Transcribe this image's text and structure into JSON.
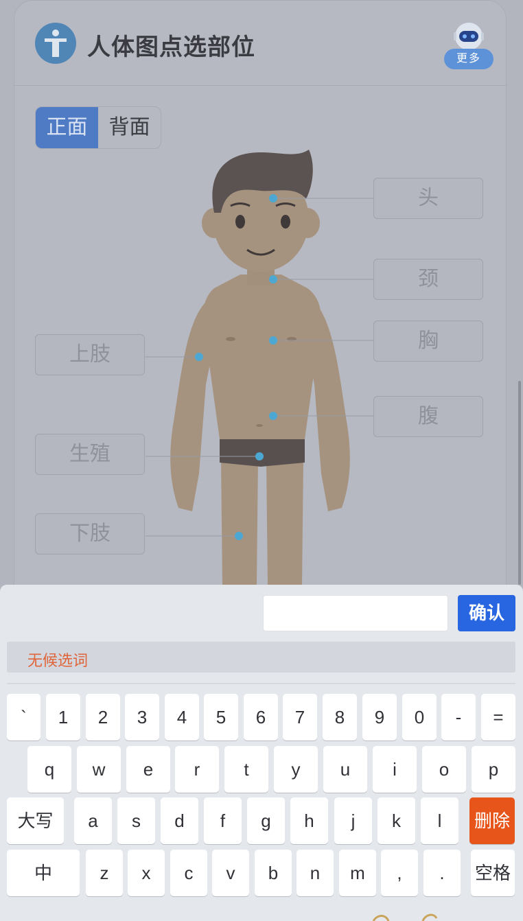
{
  "header": {
    "title": "人体图点选部位",
    "more_label": "更多"
  },
  "view_toggle": {
    "options": [
      "正面",
      "背面"
    ],
    "selected": "正面"
  },
  "body_parts": {
    "head": "头",
    "neck": "颈",
    "chest": "胸",
    "abdomen": "腹",
    "upper_limb": "上肢",
    "genital": "生殖",
    "lower_limb": "下肢"
  },
  "keyboard": {
    "confirm_label": "确认",
    "input_value": "",
    "candidates_text": "无候选词",
    "row1": [
      "`",
      "1",
      "2",
      "3",
      "4",
      "5",
      "6",
      "7",
      "8",
      "9",
      "0",
      "-",
      "="
    ],
    "row2": [
      "q",
      "w",
      "e",
      "r",
      "t",
      "y",
      "u",
      "i",
      "o",
      "p"
    ],
    "row3_shift": "大写",
    "row3": [
      "a",
      "s",
      "d",
      "f",
      "g",
      "h",
      "j",
      "k",
      "l"
    ],
    "row3_delete": "删除",
    "row4_lang": "中",
    "row4": [
      "z",
      "x",
      "c",
      "v",
      "b",
      "n",
      "m",
      ",",
      "."
    ],
    "row4_space": "空格"
  },
  "colors": {
    "accent": "#2865e0",
    "delete": "#e8551a",
    "candidate_hint": "#e0643a",
    "marker": "#4ca7d2"
  }
}
